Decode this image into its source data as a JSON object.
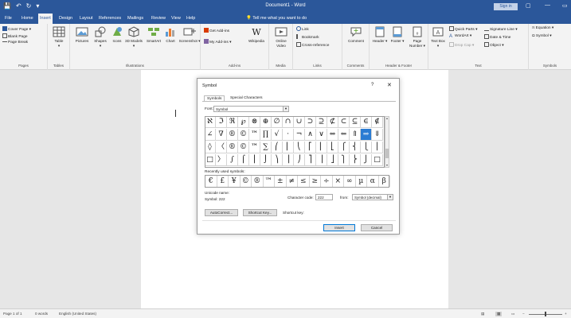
{
  "titlebar": {
    "qat": [
      "💾",
      "↶",
      "↻",
      "▾"
    ],
    "title": "Document1 - Word",
    "signin": "Sign in",
    "controls": [
      "▢",
      "—",
      "▭"
    ]
  },
  "menu": {
    "tabs": [
      "File",
      "Home",
      "Insert",
      "Design",
      "Layout",
      "References",
      "Mailings",
      "Review",
      "View",
      "Help"
    ],
    "tellme": "Tell me what you want to do"
  },
  "ribbon": {
    "pages": {
      "cover": "Cover Page",
      "blank": "Blank Page",
      "break": "Page Break",
      "label": "Pages"
    },
    "tables": {
      "table": "Table",
      "label": "Tables"
    },
    "illustrations": {
      "pictures": "Pictures",
      "shapes": "Shapes",
      "icons": "Icons",
      "models": "3D Models",
      "smartart": "SmartArt",
      "chart": "Chart",
      "screenshot": "Screenshot",
      "label": "Illustrations"
    },
    "addins": {
      "get": "Get Add-ins",
      "my": "My Add-ins",
      "wikipedia": "Wikipedia",
      "label": "Add-ins"
    },
    "media": {
      "video": "Online Video",
      "label": "Media"
    },
    "links": {
      "link": "Link",
      "bookmark": "Bookmark",
      "cross": "Cross-reference",
      "label": "Links"
    },
    "comments": {
      "comment": "Comment",
      "label": "Comments"
    },
    "hf": {
      "header": "Header",
      "footer": "Footer",
      "pagenum": "Page Number",
      "label": "Header & Footer"
    },
    "text": {
      "textbox": "Text Box",
      "quickparts": "Quick Parts",
      "wordart": "WordArt",
      "dropcap": "Drop Cap",
      "sigline": "Signature Line",
      "datetime": "Date & Time",
      "object": "Object",
      "label": "Text"
    },
    "symbols": {
      "equation": "Equation",
      "symbol": "Symbol",
      "label": "Symbols"
    }
  },
  "status": {
    "page": "Page 1 of 1",
    "words": "0 words",
    "lang": "English (United States)"
  },
  "dialog": {
    "title": "Symbol",
    "help": "?",
    "close": "✕",
    "tabs": [
      "Symbols",
      "Special Characters"
    ],
    "font_label": "Font:",
    "font_value": "Symbol",
    "grid": [
      [
        "ℵ",
        "ℑ",
        "ℜ",
        "℘",
        "⊗",
        "⊕",
        "∅",
        "∩",
        "∪",
        "⊃",
        "⊇",
        "⊄",
        "⊂",
        "⊆",
        "∈",
        "∉"
      ],
      [
        "∠",
        "∇",
        "®",
        "©",
        "™",
        "∏",
        "√",
        "⋅",
        "¬",
        "∧",
        "∨",
        "⇔",
        "⇐",
        "⇑",
        "⇒",
        "⇓"
      ],
      [
        "◊",
        "〈",
        "®",
        "©",
        "™",
        "∑",
        "⎛",
        "⎜",
        "⎝",
        "⎡",
        "⎢",
        "⎣",
        "⎧",
        "⎨",
        "⎩",
        "⎪"
      ],
      [
        "□",
        "〉",
        "∫",
        "⌠",
        "⎮",
        "⌡",
        "⎞",
        "⎟",
        "⎠",
        "⎤",
        "⎥",
        "⎦",
        "⎫",
        "⎬",
        "⎭",
        "□"
      ]
    ],
    "recent_label": "Recently used symbols:",
    "recent": [
      "€",
      "£",
      "¥",
      "©",
      "®",
      "™",
      "±",
      "≠",
      "≤",
      "≥",
      "÷",
      "×",
      "∞",
      "µ",
      "α",
      "β"
    ],
    "unicode_name_label": "Unicode name:",
    "unicode_name_value": "Symbol: 222",
    "char_code_label": "Character code:",
    "char_code_value": "222",
    "from_label": "from:",
    "from_value": "Symbol (decimal)",
    "autocorrect": "AutoCorrect...",
    "shortcut_key_btn": "Shortcut Key...",
    "shortcut_key_label": "Shortcut key:",
    "insert": "Insert",
    "cancel": "Cancel"
  }
}
